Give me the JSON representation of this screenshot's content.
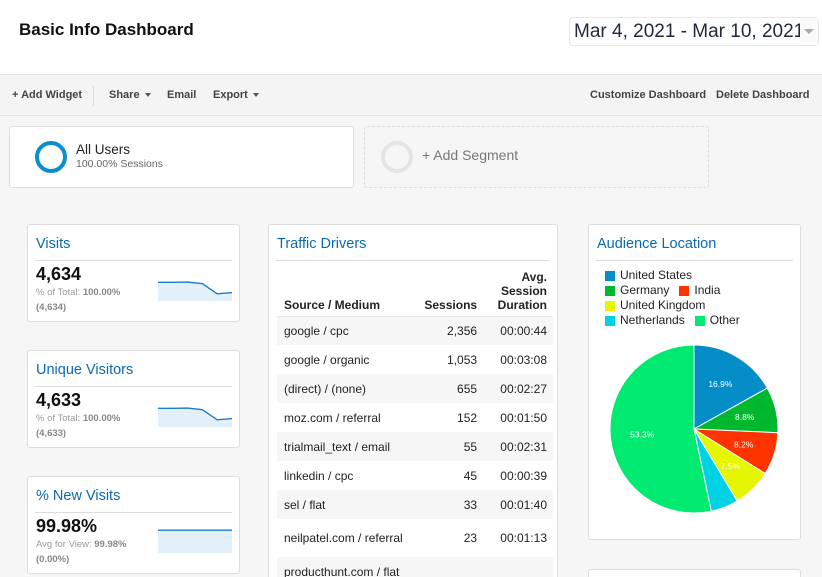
{
  "header": {
    "title": "Basic Info Dashboard",
    "date_range": "Mar 4, 2021 - Mar 10, 2021"
  },
  "toolbar": {
    "add_widget": "+ Add Widget",
    "share": "Share",
    "email": "Email",
    "export": "Export",
    "customize": "Customize Dashboard",
    "delete": "Delete Dashboard"
  },
  "segments": {
    "active": {
      "name": "All Users",
      "subtitle": "100.00% Sessions",
      "color": "#0a8ed0"
    },
    "add_label": "+ Add Segment"
  },
  "metrics": [
    {
      "title": "Visits",
      "value": "4,634",
      "sub_label": "% of Total:",
      "sub_value": "100.00%",
      "sub_paren": "(4,634)",
      "trend": [
        0.78,
        0.78,
        0.79,
        0.72,
        0.3,
        0.35
      ]
    },
    {
      "title": "Unique Visitors",
      "value": "4,633",
      "sub_label": "% of Total:",
      "sub_value": "100.00%",
      "sub_paren": "(4,633)",
      "trend": [
        0.78,
        0.78,
        0.79,
        0.72,
        0.3,
        0.35
      ]
    },
    {
      "title": "% New Visits",
      "value": "99.98%",
      "sub_label": "Avg for View:",
      "sub_value": "99.98%",
      "sub_paren": "(0.00%)",
      "trend": [
        0.95,
        0.95,
        0.95,
        0.95,
        0.95,
        0.95
      ]
    }
  ],
  "traffic": {
    "title": "Traffic Drivers",
    "columns": [
      "Source / Medium",
      "Sessions",
      "Avg. Session Duration"
    ],
    "rows": [
      {
        "source": "google / cpc",
        "sessions": "2,356",
        "duration": "00:00:44"
      },
      {
        "source": "google / organic",
        "sessions": "1,053",
        "duration": "00:03:08"
      },
      {
        "source": "(direct) / (none)",
        "sessions": "655",
        "duration": "00:02:27"
      },
      {
        "source": "moz.com / referral",
        "sessions": "152",
        "duration": "00:01:50"
      },
      {
        "source": "trialmail_text / email",
        "sessions": "55",
        "duration": "00:02:31"
      },
      {
        "source": "linkedin / cpc",
        "sessions": "45",
        "duration": "00:00:39"
      },
      {
        "source": "sel / flat",
        "sessions": "33",
        "duration": "00:01:40"
      },
      {
        "source": "neilpatel.com / referral",
        "sessions": "23",
        "duration": "00:01:13"
      },
      {
        "source": "producthunt.com / flat",
        "sessions": "",
        "duration": ""
      }
    ]
  },
  "audience": {
    "title": "Audience Location",
    "legend_rows": [
      [
        0
      ],
      [
        1,
        2
      ],
      [
        3
      ],
      [
        4,
        5
      ]
    ]
  },
  "chart_data": {
    "type": "pie",
    "title": "Audience Location",
    "legend_placement": "top",
    "slices": [
      {
        "label": "United States",
        "value": 16.9,
        "color": "#058dc7",
        "data_label": "16.9%"
      },
      {
        "label": "Germany",
        "value": 8.8,
        "color": "#00b82e",
        "data_label": "8.8%"
      },
      {
        "label": "India",
        "value": 8.2,
        "color": "#ff3300",
        "data_label": "8.2%"
      },
      {
        "label": "United Kingdom",
        "value": 7.5,
        "color": "#e6f600",
        "data_label": "7.5%"
      },
      {
        "label": "Netherlands",
        "value": 5.3,
        "color": "#00d2e6",
        "data_label": ""
      },
      {
        "label": "Other",
        "value": 53.3,
        "color": "#00ea72",
        "data_label": "53.3%"
      }
    ]
  }
}
